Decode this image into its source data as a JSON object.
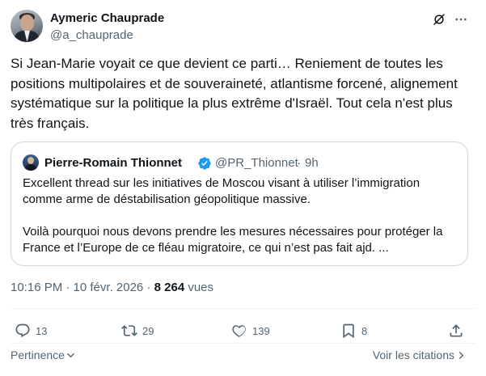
{
  "author": {
    "display_name": "Aymeric Chauprade",
    "handle": "@a_chauprade"
  },
  "tweet": {
    "text": "Si Jean-Marie voyait ce que devient ce parti… Reniement de toutes les positions multipolaires et de souveraineté, atlantisme forcené, alignement systématique sur la politique la plus extrême d'Israël. Tout cela n'est plus très français."
  },
  "quote": {
    "display_name": "Pierre-Romain Thionnet",
    "handle": "@PR_Thionnet",
    "separator": "·",
    "time": "9h",
    "lines": [
      "Excellent thread sur les initiatives de Moscou visant à utiliser l’immigration",
      "comme arme de déstabilisation géopolitique massive.",
      "",
      "Voilà pourquoi nous devons prendre les mesures nécessaires pour protéger la",
      "France et l’Europe de ce fléau migratoire, ce qui n’est pas fait ajd. ..."
    ]
  },
  "meta": {
    "timestamp": "10:16 PM · 10 févr. 2026",
    "separator": " · ",
    "views_count": "8 264",
    "views_label": " vues"
  },
  "actions": {
    "replies": "13",
    "reposts": "29",
    "likes": "139",
    "bookmarks": "8"
  },
  "footer": {
    "sort_label": "Pertinence",
    "quotes_label": "Voir les citations"
  },
  "icons": [
    "grok-icon",
    "more-icon",
    "verified-icon",
    "reply-icon",
    "repost-icon",
    "like-icon",
    "bookmark-icon",
    "share-icon",
    "chevron-down-icon",
    "chevron-right-icon"
  ],
  "colors": {
    "text": "#0f1419",
    "secondary": "#536471",
    "border": "#cfd9de",
    "verified": "#1d9bf0"
  }
}
